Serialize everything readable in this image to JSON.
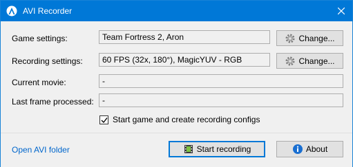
{
  "window": {
    "title": "AVI Recorder"
  },
  "fields": {
    "game_settings": {
      "label": "Game settings:",
      "value": "Team Fortress 2, Aron",
      "button": "Change..."
    },
    "recording_settings": {
      "label": "Recording settings:",
      "value": "60 FPS (32x, 180°), MagicYUV - RGB",
      "button": "Change..."
    },
    "current_movie": {
      "label": "Current movie:",
      "value": "-"
    },
    "last_frame": {
      "label": "Last frame processed:",
      "value": "-"
    }
  },
  "options": {
    "start_game_label": "Start game and create recording configs",
    "start_game_checked": true
  },
  "footer": {
    "open_folder_link": "Open AVI folder",
    "start_button": "Start recording",
    "about_button": "About"
  },
  "colors": {
    "titlebar": "#0078d7",
    "link": "#0066cc"
  }
}
